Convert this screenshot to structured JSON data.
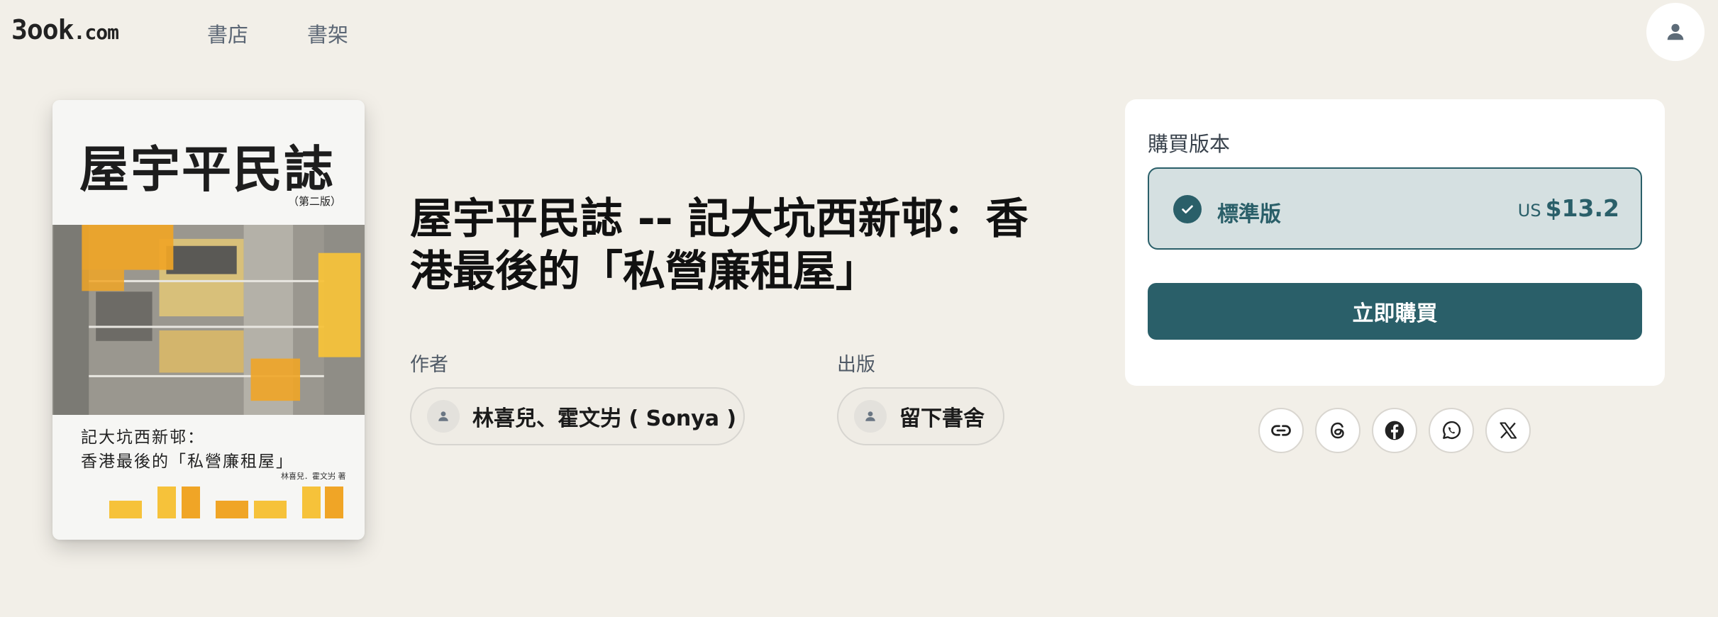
{
  "header": {
    "logo_main": "3ook",
    "logo_suffix": ".com",
    "nav": [
      {
        "label": "書店"
      },
      {
        "label": "書架"
      }
    ],
    "avatar_icon": "user-icon"
  },
  "cover": {
    "title": "屋宇平民誌",
    "edition": "（第二版）",
    "subtitle_line1": "記大坑西新邨：",
    "subtitle_line2": "香港最後的「私營廉租屋」",
    "author": "林喜兒．霍文屴 著",
    "accent_color": "#f0a526"
  },
  "book": {
    "title": "屋宇平民誌 -- 記大坑西新邨：香港最後的「私營廉租屋」",
    "author_label": "作者",
    "author_name": "林喜兒、霍文屴 ( Sonya )",
    "publisher_label": "出版",
    "publisher_name": "留下書舍"
  },
  "purchase": {
    "label": "購買版本",
    "edition_name": "標準版",
    "currency": "US",
    "price": "$13.2",
    "selected": true,
    "buy_label": "立即購買",
    "accent_color": "#2a5f69"
  },
  "share": [
    {
      "icon": "link-icon"
    },
    {
      "icon": "threads-icon"
    },
    {
      "icon": "facebook-icon"
    },
    {
      "icon": "whatsapp-icon"
    },
    {
      "icon": "x-icon"
    }
  ]
}
